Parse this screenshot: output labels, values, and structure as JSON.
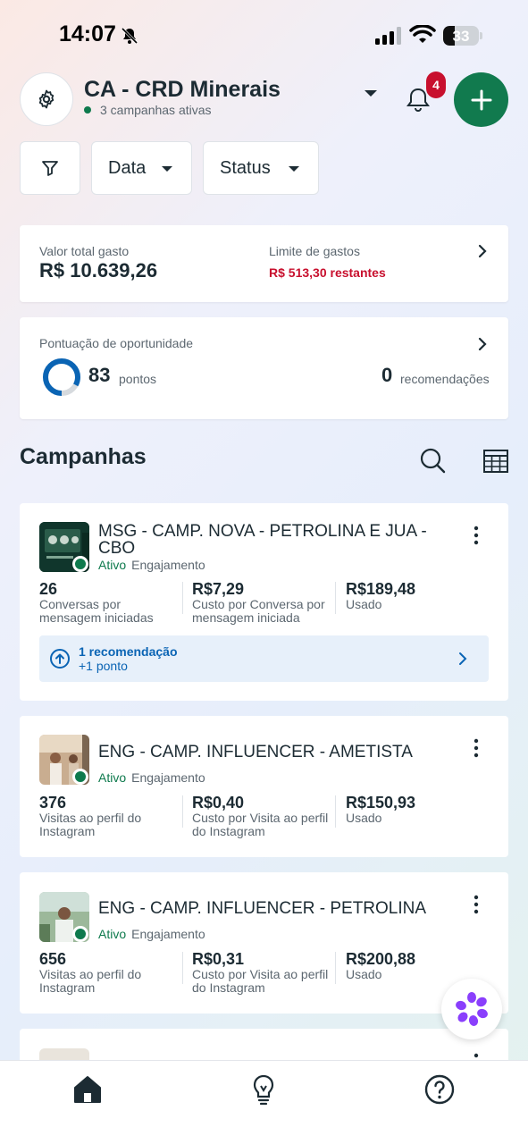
{
  "status_bar": {
    "time": "14:07",
    "battery": "33",
    "battery_level": 0.33
  },
  "header": {
    "account_name": "CA - CRD Minerais",
    "account_subtitle": "3 campanhas ativas",
    "notification_count": "4",
    "accent_color": "#117a4e"
  },
  "filters": {
    "data_label": "Data",
    "status_label": "Status"
  },
  "spend": {
    "total_label": "Valor total gasto",
    "total_value": "R$ 10.639,26",
    "limit_label": "Limite de gastos",
    "limit_value": "R$ 513,30 restantes"
  },
  "opportunity": {
    "label": "Pontuação de oportunidade",
    "score": "83",
    "score_unit": "pontos",
    "score_fraction": 0.83,
    "recommendations": "0",
    "recommendations_unit": "recomendações"
  },
  "campaigns_section": {
    "title": "Campanhas"
  },
  "campaigns": [
    {
      "name": "MSG - CAMP. NOVA - PETROLINA E JUA  - CBO",
      "status": "Ativo",
      "objective": "Engajamento",
      "metrics": [
        {
          "value": "26",
          "label": "Conversas por mensagem iniciadas"
        },
        {
          "value": "R$7,29",
          "label": "Custo por Conversa por mensagem iniciada"
        },
        {
          "value": "R$189,48",
          "label": "Usado"
        }
      ],
      "recommendation": {
        "title": "1 recomendação",
        "subtitle": "+1 ponto"
      }
    },
    {
      "name": "ENG - CAMP. INFLUENCER - AMETISTA",
      "status": "Ativo",
      "objective": "Engajamento",
      "metrics": [
        {
          "value": "376",
          "label": "Visitas ao perfil do Instagram"
        },
        {
          "value": "R$0,40",
          "label": "Custo por Visita ao perfil do Instagram"
        },
        {
          "value": "R$150,93",
          "label": "Usado"
        }
      ]
    },
    {
      "name": "ENG - CAMP. INFLUENCER - PETROLINA",
      "status": "Ativo",
      "objective": "Engajamento",
      "metrics": [
        {
          "value": "656",
          "label": "Visitas ao perfil do Instagram"
        },
        {
          "value": "R$0,31",
          "label": "Custo por Visita ao perfil do Instagram"
        },
        {
          "value": "R$200,88",
          "label": "Usado"
        }
      ]
    }
  ],
  "bottom_nav": [
    "home-icon",
    "lightbulb-icon",
    "help-icon"
  ]
}
